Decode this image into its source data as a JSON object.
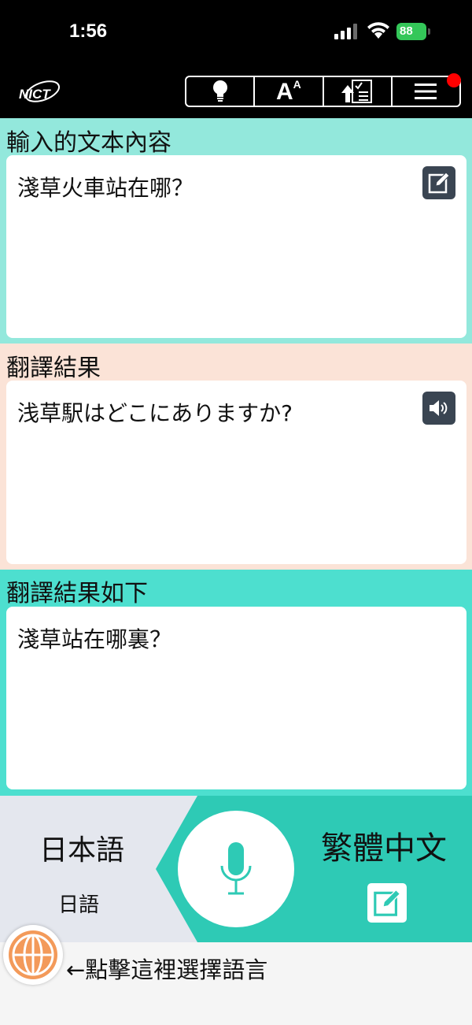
{
  "status_bar": {
    "time": "1:56",
    "battery": "88"
  },
  "header": {
    "logo_text": "NICT",
    "toolbar": [
      {
        "name": "hint-icon"
      },
      {
        "name": "font-size-icon",
        "label": "A",
        "sup": "A"
      },
      {
        "name": "upload-checklist-icon"
      },
      {
        "name": "menu-icon"
      }
    ]
  },
  "input_panel": {
    "title": "輸入的文本內容",
    "text": "淺草火車站在哪？"
  },
  "result_panel": {
    "title": "翻譯結果",
    "text": "浅草駅はどこにありますか?"
  },
  "back_panel": {
    "title": "翻譯結果如下",
    "text": "淺草站在哪裏？"
  },
  "language_bar": {
    "source_language": "日本語",
    "source_language_sub": "日語",
    "target_language": "繁體中文"
  },
  "footer": {
    "hint": "←點擊這裡選擇語言"
  },
  "colors": {
    "input_bg": "#93e8dc",
    "result_bg": "#fbe3d7",
    "back_bg": "#4ddfcf",
    "target_lang_bg": "#2ecab5",
    "globe_orange": "#f39a5a",
    "notify_red": "#ff0000"
  }
}
